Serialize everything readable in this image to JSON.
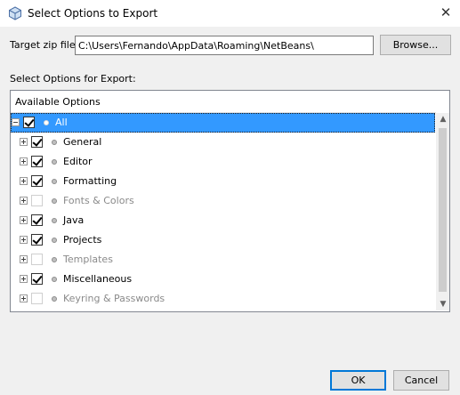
{
  "window": {
    "title": "Select Options to Export",
    "close_glyph": "✕"
  },
  "target": {
    "label": "Target zip file:",
    "value": "C:\\Users\\Fernando\\AppData\\Roaming\\NetBeans\\"
  },
  "buttons": {
    "browse": "Browse...",
    "ok": "OK",
    "cancel": "Cancel"
  },
  "options_label": "Select Options for Export:",
  "tree": {
    "header": "Available Options",
    "items": [
      {
        "label": "All",
        "checked": true,
        "enabled": true,
        "expanded": true,
        "selected": true
      },
      {
        "label": "General",
        "checked": true,
        "enabled": true,
        "expanded": false
      },
      {
        "label": "Editor",
        "checked": true,
        "enabled": true,
        "expanded": false
      },
      {
        "label": "Formatting",
        "checked": true,
        "enabled": true,
        "expanded": false
      },
      {
        "label": "Fonts & Colors",
        "checked": false,
        "enabled": false,
        "expanded": false
      },
      {
        "label": "Java",
        "checked": true,
        "enabled": true,
        "expanded": false
      },
      {
        "label": "Projects",
        "checked": true,
        "enabled": true,
        "expanded": false
      },
      {
        "label": "Templates",
        "checked": false,
        "enabled": false,
        "expanded": false
      },
      {
        "label": "Miscellaneous",
        "checked": true,
        "enabled": true,
        "expanded": false
      },
      {
        "label": "Keyring & Passwords",
        "checked": false,
        "enabled": false,
        "expanded": false
      }
    ]
  },
  "colors": {
    "selection": "#3399ff",
    "accent": "#0078d7",
    "muted_text": "#8a8a8a"
  },
  "icons": {
    "app": "netbeans-cube-icon",
    "toggle": "tree-expand-icon",
    "node": "option-node-icon"
  }
}
